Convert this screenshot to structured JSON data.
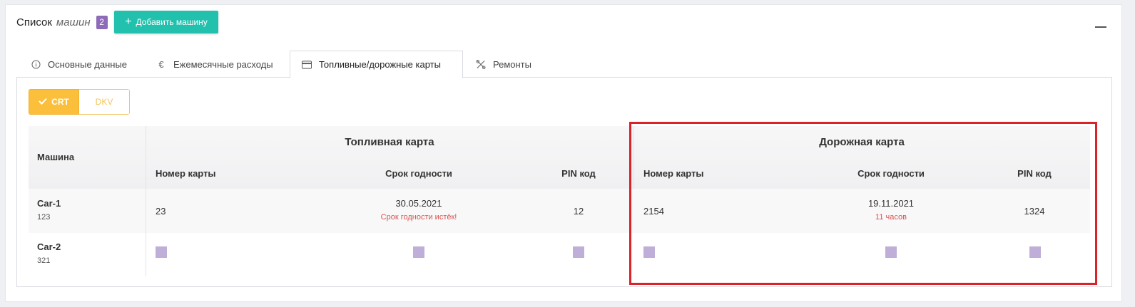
{
  "header": {
    "title": "Список",
    "subtitle": "машин",
    "count": "2",
    "add_button": "Добавить машину"
  },
  "tabs": [
    {
      "label": "Основные данные",
      "icon": "info-icon"
    },
    {
      "label": "Ежемесячные расходы",
      "icon": "euro-icon"
    },
    {
      "label": "Топливные/дорожные карты",
      "icon": "credit-card-icon",
      "active": true
    },
    {
      "label": "Ремонты",
      "icon": "tools-icon"
    }
  ],
  "toggle": {
    "crt": "CRT",
    "dkv": "DKV",
    "selected": "CRT"
  },
  "table": {
    "machine_header": "Машина",
    "fuel_card_header": "Топливная карта",
    "road_card_header": "Дорожная карта",
    "col_card_number": "Номер карты",
    "col_expiry": "Срок годности",
    "col_pin": "PIN код",
    "rows": [
      {
        "name": "Car-1",
        "plate": "123",
        "fuel": {
          "number": "23",
          "expiry": "30.05.2021",
          "expiry_note": "Срок годности истёк!",
          "pin": "12"
        },
        "road": {
          "number": "2154",
          "expiry": "19.11.2021",
          "expiry_note": "11 часов",
          "pin": "1324"
        }
      },
      {
        "name": "Car-2",
        "plate": "321"
      }
    ]
  },
  "colors": {
    "accent": "#22c1ae",
    "badge": "#8e6bb8",
    "toggle": "#fbbf3b",
    "warning": "#d9534f",
    "highlight": "#d9222a",
    "placeholder": "#bfaed8"
  }
}
